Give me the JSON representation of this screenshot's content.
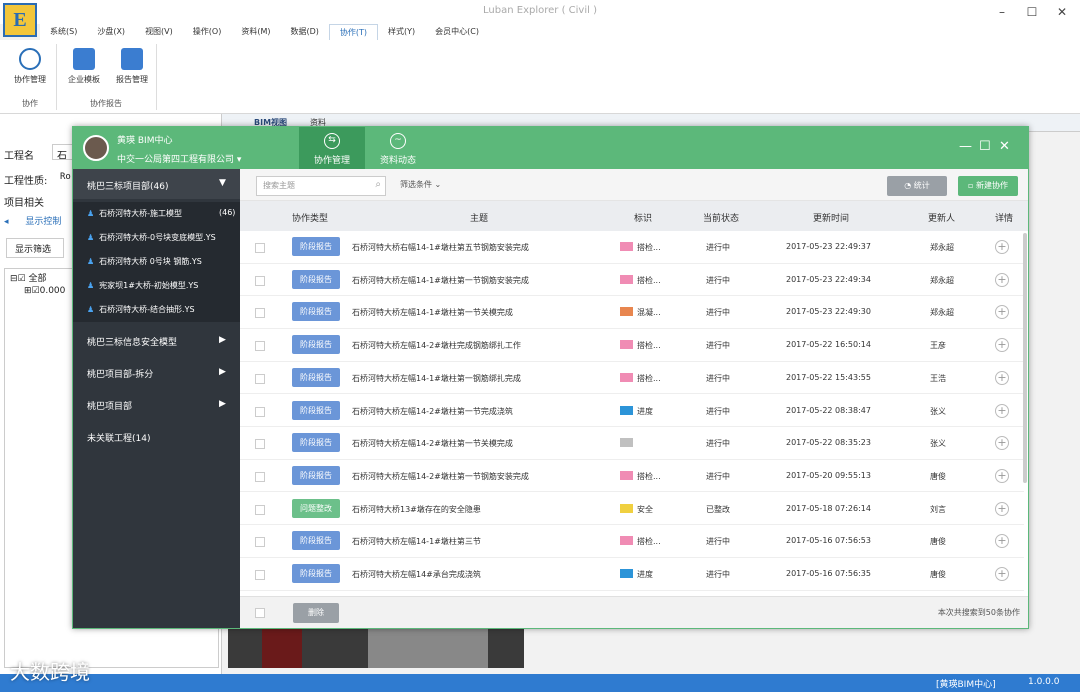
{
  "app": {
    "title": "Luban Explorer ( Civil )",
    "window_controls": [
      "–",
      "☐",
      "✕"
    ]
  },
  "menu": [
    "系统(S)",
    "沙盘(X)",
    "视图(V)",
    "操作(O)",
    "资料(M)",
    "数据(D)",
    "协作(T)",
    "样式(Y)",
    "会员中心(C)"
  ],
  "ribbon": {
    "buttons": [
      {
        "label": "协作管理"
      },
      {
        "label": "企业模板"
      },
      {
        "label": "报告管理"
      }
    ],
    "groups": [
      "协作",
      "协作报告"
    ]
  },
  "left_pane": {
    "project_name_label": "工程名",
    "project_name_value": "石桥",
    "property_label": "工程性质:",
    "property_value": "Ro",
    "related_label": "项目相关",
    "tab_label": "显示控制",
    "filter_btn": "显示筛选",
    "tree_all": "全部",
    "tree_sub": "0.000"
  },
  "doc_tabs": [
    "BIM视图",
    "资料"
  ],
  "dialog": {
    "user_name": "黄瑛  BIM中心",
    "org": "中交一公局第四工程有限公司",
    "tabs": [
      {
        "label": "协作管理"
      },
      {
        "label": "资料动态"
      }
    ],
    "sidebar": {
      "head": "桃巴三标项目部(46)",
      "items": [
        {
          "label": "石桥河特大桥-施工模型",
          "count": "(46)"
        },
        {
          "label": "石桥河特大桥-0号块变底模型.YS",
          "count": ""
        },
        {
          "label": "石桥河特大桥 0号块 钢筋.YS",
          "count": ""
        },
        {
          "label": "宪家坝1#大桥-初始模型.YS",
          "count": ""
        },
        {
          "label": "石桥河特大桥-结合抽形.YS",
          "count": ""
        }
      ],
      "groups": [
        "桃巴三标信息安全模型",
        "桃巴项目部-拆分",
        "桃巴项目部",
        "未关联工程(14)"
      ]
    },
    "toolbar": {
      "search_placeholder": "搜索主题",
      "filter": "筛选条件",
      "stat_btn": "统计",
      "new_btn": "新建协作"
    },
    "headers": [
      "协作类型",
      "主题",
      "标识",
      "当前状态",
      "更新时间",
      "更新人",
      "详情"
    ],
    "rows": [
      {
        "type": "阶段报告",
        "subject": "石桥河特大桥右幅14-1#墩柱第五节钢筋安装完成",
        "mark": "搭检...",
        "mark_color": "#f08cb4",
        "status": "进行中",
        "time": "2017-05-23 22:49:37",
        "user": "郑永超"
      },
      {
        "type": "阶段报告",
        "subject": "石桥河特大桥左幅14-1#墩柱第一节钢筋安装完成",
        "mark": "搭检...",
        "mark_color": "#f08cb4",
        "status": "进行中",
        "time": "2017-05-23 22:49:34",
        "user": "郑永超"
      },
      {
        "type": "阶段报告",
        "subject": "石桥河特大桥左幅14-1#墩柱第一节关模完成",
        "mark": "混凝...",
        "mark_color": "#e8864f",
        "status": "进行中",
        "time": "2017-05-23 22:49:30",
        "user": "郑永超"
      },
      {
        "type": "阶段报告",
        "subject": "石桥河特大桥左幅14-2#墩柱完成钢筋绑扎工作",
        "mark": "搭检...",
        "mark_color": "#f08cb4",
        "status": "进行中",
        "time": "2017-05-22 16:50:14",
        "user": "王彦"
      },
      {
        "type": "阶段报告",
        "subject": "石桥河特大桥左幅14-1#墩柱第一钢筋绑扎完成",
        "mark": "搭检...",
        "mark_color": "#f08cb4",
        "status": "进行中",
        "time": "2017-05-22 15:43:55",
        "user": "王浩"
      },
      {
        "type": "阶段报告",
        "subject": "石桥河特大桥左幅14-2#墩柱第一节完成浇筑",
        "mark": "进度",
        "mark_color": "#2c94d8",
        "status": "进行中",
        "time": "2017-05-22 08:38:47",
        "user": "张义"
      },
      {
        "type": "阶段报告",
        "subject": "石桥河特大桥左幅14-2#墩柱第一节关模完成",
        "mark": "",
        "mark_color": "#c0c0c0",
        "status": "进行中",
        "time": "2017-05-22 08:35:23",
        "user": "张义"
      },
      {
        "type": "阶段报告",
        "subject": "石桥河特大桥左幅14-2#墩柱第一节钢筋安装完成",
        "mark": "搭检...",
        "mark_color": "#f08cb4",
        "status": "进行中",
        "time": "2017-05-20 09:55:13",
        "user": "唐俊"
      },
      {
        "type": "问题整改",
        "subject": "石桥河特大桥13#墩存在的安全隐患",
        "mark": "安全",
        "mark_color": "#f0d040",
        "status": "已整改",
        "time": "2017-05-18 07:26:14",
        "user": "刘言"
      },
      {
        "type": "阶段报告",
        "subject": "石桥河特大桥左幅14-1#墩柱第三节",
        "mark": "搭检...",
        "mark_color": "#f08cb4",
        "status": "进行中",
        "time": "2017-05-16 07:56:53",
        "user": "唐俊"
      },
      {
        "type": "阶段报告",
        "subject": "石桥河特大桥左幅14#承台完成浇筑",
        "mark": "进度",
        "mark_color": "#2c94d8",
        "status": "进行中",
        "time": "2017-05-16 07:56:35",
        "user": "唐俊"
      }
    ],
    "footer": {
      "delete_btn": "删除",
      "summary": "本次共搜索到50条协作"
    }
  },
  "status": {
    "user": "[黄瑛BIM中心]",
    "version": "1.0.0.0"
  },
  "watermark": "大数跨境",
  "colors": {
    "green": "#5cb87a",
    "sidebar": "#30363d",
    "tag_blue": "#6b96d8",
    "tag_green": "#6cc08a",
    "status_blue": "#2f7bd0"
  }
}
